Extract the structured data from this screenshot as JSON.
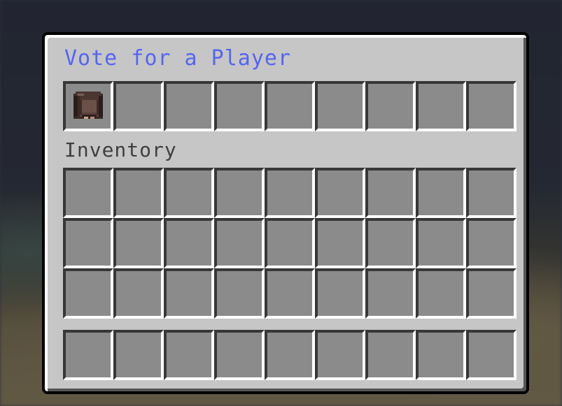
{
  "window": {
    "title": "Vote for a Player",
    "inventory_label": "Inventory"
  },
  "vote_row": {
    "slots": [
      {
        "item": "player-head",
        "icon": "player-head-icon"
      },
      {
        "item": ""
      },
      {
        "item": ""
      },
      {
        "item": ""
      },
      {
        "item": ""
      },
      {
        "item": ""
      },
      {
        "item": ""
      },
      {
        "item": ""
      },
      {
        "item": ""
      }
    ]
  },
  "inventory": {
    "rows": 3,
    "columns": 9
  },
  "hotbar": {
    "columns": 9
  },
  "colors": {
    "title": "#5565f0",
    "label": "#3f3f3f",
    "panel": "#c6c6c6",
    "slot": "#8b8b8b"
  }
}
